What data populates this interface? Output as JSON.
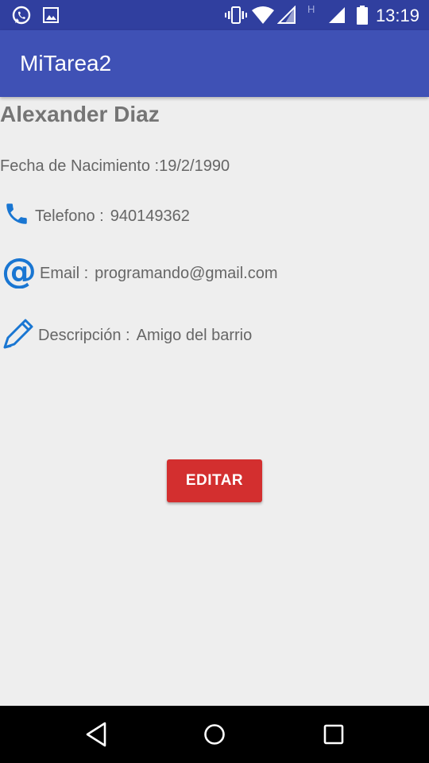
{
  "status_bar": {
    "time": "13:19",
    "left_icons": [
      "whatsapp-icon",
      "image-icon"
    ],
    "right_icons": [
      "vibrate-icon",
      "wifi-icon",
      "signal-icon",
      "signal-icon"
    ],
    "network_type": "H"
  },
  "app_bar": {
    "title": "MiTarea2"
  },
  "contact": {
    "name": "Alexander Diaz",
    "birth_label": "Fecha de Nacimiento :",
    "birth_value": "19/2/1990",
    "phone_label": "Telefono :",
    "phone_value": "940149362",
    "email_label": "Email :",
    "email_value": "programando@gmail.com",
    "description_label": "Descripción :",
    "description_value": "Amigo del barrio"
  },
  "actions": {
    "edit_label": "EDITAR"
  },
  "nav_bar": {
    "buttons": [
      "back-icon",
      "home-icon",
      "recents-icon"
    ]
  },
  "colors": {
    "status_bar": "#303f9f",
    "app_bar": "#3f51b5",
    "accent_icon": "#1976d2",
    "button": "#d32f2f",
    "background": "#eeeeee"
  }
}
